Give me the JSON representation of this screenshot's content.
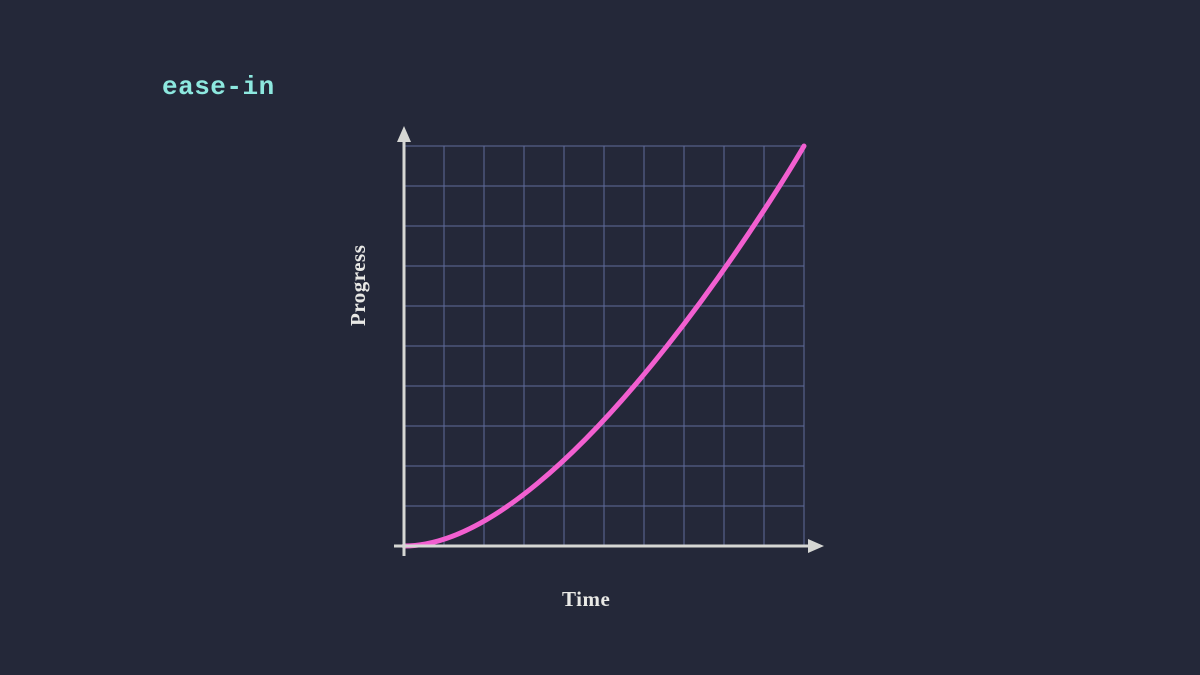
{
  "title": "ease-in",
  "chart_data": {
    "type": "line",
    "title": "ease-in",
    "xlabel": "Time",
    "ylabel": "Progress",
    "xlim": [
      0,
      1
    ],
    "ylim": [
      0,
      1
    ],
    "grid": true,
    "grid_divisions": 10,
    "bezier": {
      "p0": [
        0,
        0
      ],
      "p1": [
        0.42,
        0
      ],
      "p2": [
        1,
        1
      ],
      "p3": [
        1,
        1
      ]
    },
    "series": [
      {
        "name": "ease-in",
        "color": "#f25fd0",
        "x": [
          0.0,
          0.1,
          0.2,
          0.3,
          0.4,
          0.5,
          0.6,
          0.7,
          0.8,
          0.9,
          1.0
        ],
        "values": [
          0.0,
          0.02,
          0.06,
          0.13,
          0.21,
          0.32,
          0.45,
          0.59,
          0.73,
          0.87,
          1.0
        ]
      }
    ]
  },
  "colors": {
    "bg": "#242839",
    "grid": "#5f6b9c",
    "axis": "#d6d7d4",
    "curve": "#f25fd0",
    "title": "#8de8df",
    "label": "#e9e9e6"
  }
}
